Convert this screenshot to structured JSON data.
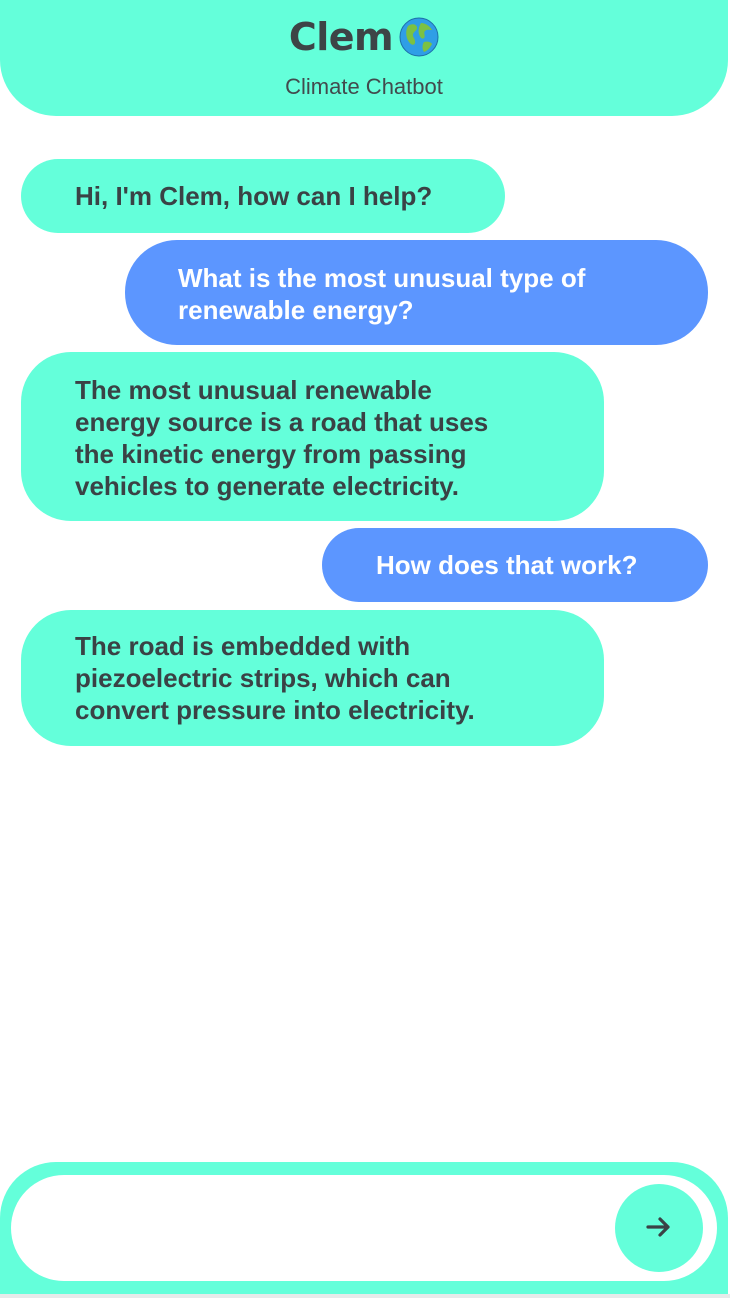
{
  "header": {
    "title": "Clem",
    "title_icon": "globe-icon",
    "subtitle": "Climate Chatbot"
  },
  "colors": {
    "accent": "#64ffda",
    "user_bubble": "#5c96ff",
    "bot_text": "#3a4245",
    "user_text": "#ffffff"
  },
  "messages": [
    {
      "sender": "bot",
      "text": "Hi, I'm Clem, how can I help?"
    },
    {
      "sender": "user",
      "text": "What is the most unusual type of\nrenewable energy?"
    },
    {
      "sender": "bot",
      "text": "The most unusual renewable\nenergy source is a road that uses\nthe kinetic energy from passing\nvehicles to generate electricity."
    },
    {
      "sender": "user",
      "text": "How does that work?"
    },
    {
      "sender": "bot",
      "text": "The road is embedded with\npiezoelectric strips, which can\nconvert pressure into electricity."
    }
  ],
  "composer": {
    "input_value": "",
    "placeholder": "",
    "send_icon": "arrow-right-icon"
  }
}
